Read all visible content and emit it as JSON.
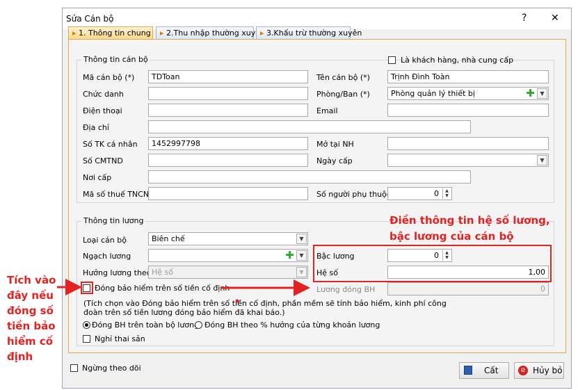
{
  "window": {
    "title": "Sửa Cán bộ",
    "help_label": "?",
    "close_label": "✕"
  },
  "tabs": [
    {
      "label": "1. Thông tin chung",
      "active": true
    },
    {
      "label": "2.Thu nhập thường xuyên",
      "active": false
    },
    {
      "label": "3.Khấu trừ thường xuyên",
      "active": false
    }
  ],
  "officer_info": {
    "section_title": "Thông tin cán bộ",
    "is_customer_label": "Là khách hàng, nhà cung cấp",
    "is_customer_checked": false,
    "code_label": "Mã cán bộ (*)",
    "code_value": "TDToan",
    "name_label": "Tên cán bộ (*)",
    "name_value": "Trịnh Đình Toàn",
    "title_label": "Chức danh",
    "title_value": "",
    "department_label": "Phòng/Ban (*)",
    "department_value": "Phòng quản lý thiết bị",
    "phone_label": "Điện thoại",
    "phone_value": "",
    "email_label": "Email",
    "email_value": "",
    "address_label": "Địa chỉ",
    "address_value": "",
    "account_label": "Số TK cá nhân",
    "account_value": "1452997798",
    "bank_label": "Mở tại NH",
    "bank_value": "",
    "id_label": "Số CMTND",
    "id_value": "",
    "issue_date_label": "Ngày cấp",
    "issue_date_value": "",
    "issue_place_label": "Nơi cấp",
    "issue_place_value": "",
    "tax_label": "Mã số thuế TNCN",
    "tax_value": "",
    "dependents_label": "Số người phụ thuộc",
    "dependents_value": "0"
  },
  "salary_info": {
    "section_title": "Thông tin lương",
    "type_label": "Loại cán bộ",
    "type_value": "Biên chế",
    "grade_label": "Ngạch lương",
    "grade_value": "",
    "salary_by_label": "Hưởng lương theo",
    "salary_by_value": "Hệ số",
    "step_label": "Bậc lương",
    "step_value": "0",
    "coefficient_label": "Hệ số",
    "coefficient_value": "1,00",
    "fixed_insurance_label": "Đóng bảo hiểm trên số tiền cố định",
    "fixed_insurance_checked": false,
    "insurance_salary_label": "Lương đóng BH",
    "insurance_salary_value": "0",
    "note_line1": "(Tích chọn vào Đóng bảo hiểm trên số tiền cố định, phần mềm sẽ tính bảo hiểm, kinh phí công",
    "note_line2": "đoàn trên số tiền lương đóng bảo hiểm đã khai báo.)",
    "radio_full_label": "Đóng BH trên toàn bộ lương",
    "radio_percent_label": "Đóng BH theo % hưởng của từng khoản lương",
    "radio_selected": "full",
    "maternity_label": "Nghỉ thai sản",
    "maternity_checked": false
  },
  "footer": {
    "stop_tracking_label": "Ngừng theo dõi",
    "save_label": "Cất",
    "cancel_label": "Hủy bỏ"
  },
  "annotations": {
    "left_lines": [
      "Tích vào",
      "đây nếu",
      "đóng số",
      "tiền bảo",
      "hiểm cố",
      "định"
    ],
    "right_lines": [
      "Điền thông tin hệ số lương,",
      "bậc lương của cán bộ"
    ],
    "color": "#e32222"
  }
}
